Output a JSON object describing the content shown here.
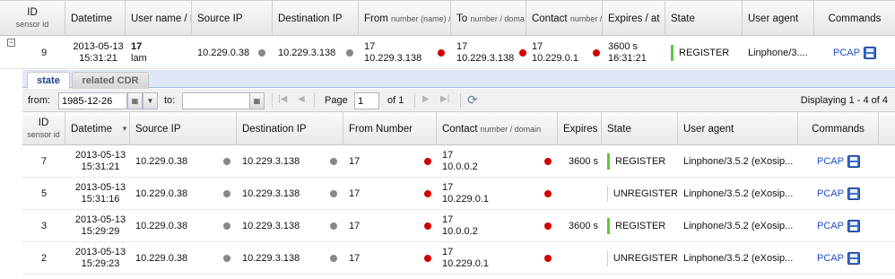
{
  "outer": {
    "headers": {
      "id": "ID",
      "sensor": "sensor id",
      "datetime": "Datetime",
      "username": "User name / R",
      "srcip": "Source IP",
      "dstip": "Destination IP",
      "from": "From",
      "from_small": "number (name) /",
      "to": "To",
      "to_small": "number / doma",
      "contact": "Contact",
      "contact_small": "number /",
      "expires": "Expires / at",
      "state": "State",
      "useragent": "User agent",
      "commands": "Commands"
    },
    "row": {
      "expander": "−",
      "id": "9",
      "date": "2013-05-13",
      "time": "15:31:21",
      "user_num": "17",
      "user_name": "lam",
      "srcip": "10.229.0.38",
      "dstip": "10.229.3.138",
      "from_num": "17",
      "from_ip": "10.229.3.138",
      "to_num": "17",
      "to_ip": "10.229.3.138",
      "contact_num": "17",
      "contact_ip": "10.229.0.1",
      "expires": "3600 s",
      "expires_at": "16:31:21",
      "state": "REGISTER",
      "useragent": "Linphone/3....",
      "pcap": "PCAP"
    }
  },
  "tabs": [
    "state",
    "related CDR"
  ],
  "toolbar": {
    "from_label": "from:",
    "from_value": "1985-12-26",
    "to_label": "to:",
    "to_value": "",
    "page_label": "Page",
    "page_value": "1",
    "of_label": "of 1",
    "displaying": "Displaying 1 - 4 of 4"
  },
  "inner": {
    "headers": {
      "id": "ID",
      "sensor": "sensor id",
      "datetime": "Datetime",
      "srcip": "Source IP",
      "dstip": "Destination IP",
      "fromnum": "From Number",
      "contact": "Contact",
      "contact_small": "number / domain",
      "expires": "Expires",
      "state": "State",
      "useragent": "User agent",
      "commands": "Commands"
    },
    "rows": [
      {
        "id": "7",
        "date": "2013-05-13",
        "time": "15:31:21",
        "srcip": "10.229.0.38",
        "dstip": "10.229.3.138",
        "from": "17",
        "contact_num": "17",
        "contact_ip": "10.0.0.2",
        "expires": "3600 s",
        "state": "REGISTER",
        "state_color": "#5cc73a",
        "useragent": "Linphone/3.5.2 (eXosip...",
        "pcap": "PCAP"
      },
      {
        "id": "5",
        "date": "2013-05-13",
        "time": "15:31:16",
        "srcip": "10.229.0.38",
        "dstip": "10.229.3.138",
        "from": "17",
        "contact_num": "17",
        "contact_ip": "10.229.0.1",
        "expires": "",
        "state": "UNREGISTER",
        "state_color": "#f0d84a",
        "useragent": "Linphone/3.5.2 (eXosip...",
        "pcap": "PCAP"
      },
      {
        "id": "3",
        "date": "2013-05-13",
        "time": "15:29:29",
        "srcip": "10.229.0.38",
        "dstip": "10.229.3.138",
        "from": "17",
        "contact_num": "17",
        "contact_ip": "10.0.0.2",
        "expires": "3600 s",
        "state": "REGISTER",
        "state_color": "#5cc73a",
        "useragent": "Linphone/3.5.2 (eXosip...",
        "pcap": "PCAP"
      },
      {
        "id": "2",
        "date": "2013-05-13",
        "time": "15:29:23",
        "srcip": "10.229.0.38",
        "dstip": "10.229.3.138",
        "from": "17",
        "contact_num": "17",
        "contact_ip": "10.229.0.1",
        "expires": "",
        "state": "UNREGISTER",
        "state_color": "#f0d84a",
        "useragent": "Linphone/3.5.2 (eXosip...",
        "pcap": "PCAP"
      }
    ]
  },
  "icons": {
    "floppy": "save-pcap-icon",
    "refresh": "refresh-icon",
    "calendar": "calendar-icon"
  },
  "colors": {
    "ip_dot": "#888888",
    "number_dot": "#d30000",
    "link": "#1f4fc8"
  }
}
